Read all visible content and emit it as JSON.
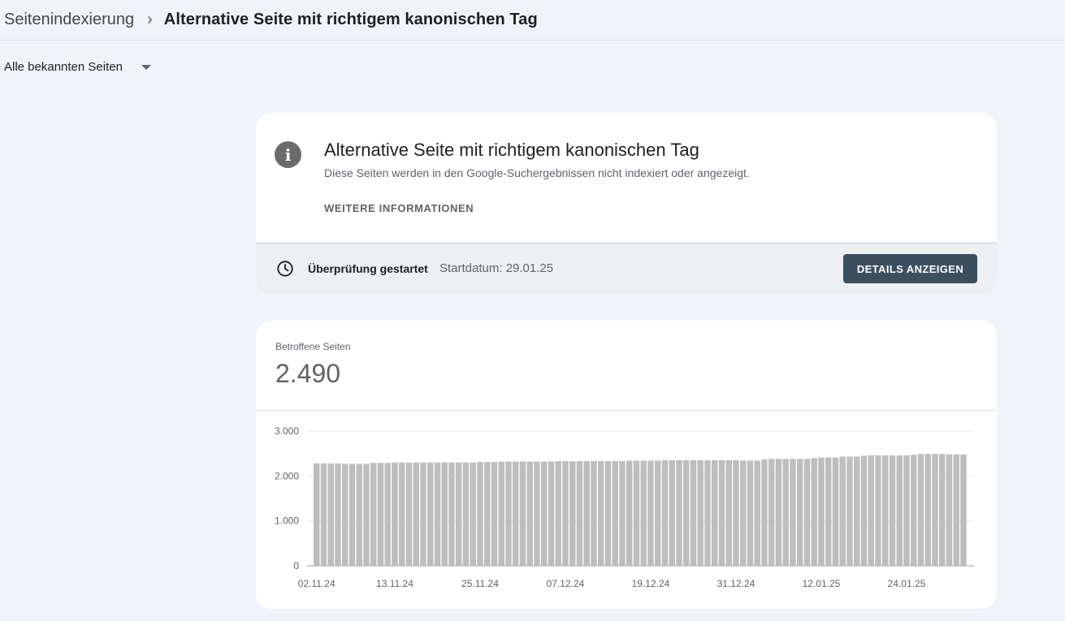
{
  "breadcrumb": {
    "parent": "Seitenindexierung",
    "separator": "›",
    "current": "Alternative Seite mit richtigem kanonischen Tag"
  },
  "filter": {
    "selected": "Alle bekannten Seiten"
  },
  "info_card": {
    "icon": "info-icon",
    "title": "Alternative Seite mit richtigem kanonischen Tag",
    "description": "Diese Seiten werden in den Google-Suchergebnissen nicht indexiert oder angezeigt.",
    "more_link": "WEITERE INFORMATIONEN"
  },
  "status": {
    "icon": "clock-icon",
    "label": "Überprüfung gestartet",
    "date": "Startdatum: 29.01.25",
    "button": "DETAILS ANZEIGEN"
  },
  "metric": {
    "label": "Betroffene Seiten",
    "value": "2.490"
  },
  "colors": {
    "accent_button": "#3c4f5f",
    "bar": "#bdbdbd",
    "background": "#f0f4f9"
  },
  "chart_data": {
    "type": "bar",
    "ylim": [
      0,
      3000
    ],
    "y_ticks": [
      {
        "value": 0,
        "label": "0"
      },
      {
        "value": 1000,
        "label": "1.000"
      },
      {
        "value": 2000,
        "label": "2.000"
      },
      {
        "value": 3000,
        "label": "3.000"
      }
    ],
    "x_tick_labels": [
      {
        "index": 0,
        "label": "02.11.24"
      },
      {
        "index": 11,
        "label": "13.11.24"
      },
      {
        "index": 23,
        "label": "25.11.24"
      },
      {
        "index": 35,
        "label": "07.12.24"
      },
      {
        "index": 47,
        "label": "19.12.24"
      },
      {
        "index": 59,
        "label": "31.12.24"
      },
      {
        "index": 71,
        "label": "12.01.25"
      },
      {
        "index": 83,
        "label": "24.01.25"
      }
    ],
    "series": [
      {
        "values": [
          2280,
          2280,
          2280,
          2280,
          2270,
          2270,
          2270,
          2270,
          2290,
          2290,
          2290,
          2300,
          2300,
          2300,
          2300,
          2300,
          2300,
          2300,
          2300,
          2300,
          2300,
          2300,
          2300,
          2310,
          2310,
          2310,
          2320,
          2320,
          2320,
          2320,
          2320,
          2320,
          2320,
          2320,
          2330,
          2330,
          2330,
          2330,
          2330,
          2330,
          2330,
          2330,
          2330,
          2330,
          2340,
          2340,
          2340,
          2340,
          2340,
          2350,
          2350,
          2350,
          2350,
          2350,
          2350,
          2350,
          2350,
          2350,
          2350,
          2350,
          2340,
          2340,
          2340,
          2370,
          2380,
          2380,
          2380,
          2380,
          2380,
          2380,
          2400,
          2410,
          2410,
          2410,
          2430,
          2430,
          2430,
          2450,
          2460,
          2460,
          2460,
          2460,
          2460,
          2460,
          2470,
          2490,
          2490,
          2490,
          2490,
          2480,
          2480,
          2480
        ]
      }
    ]
  }
}
